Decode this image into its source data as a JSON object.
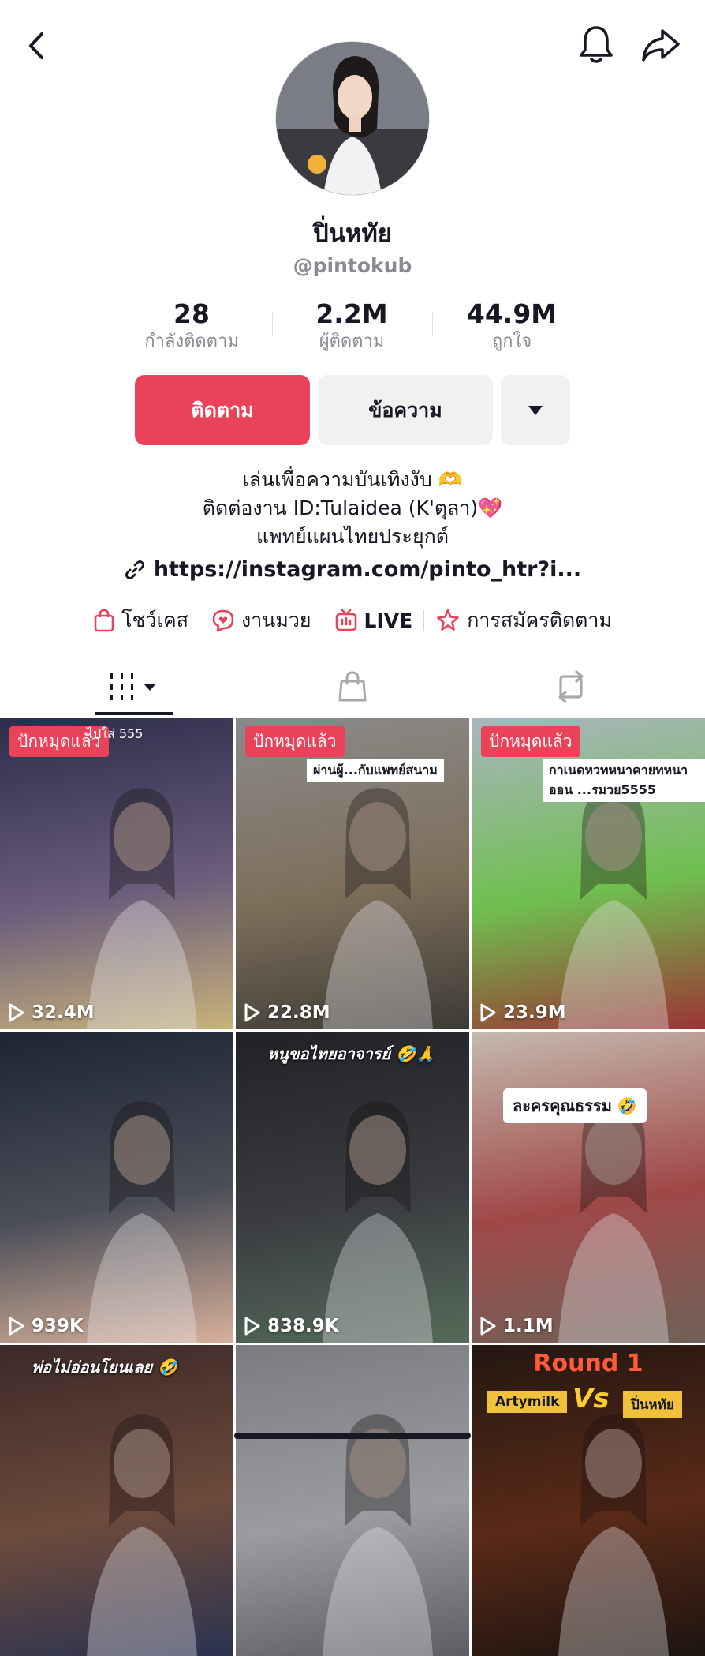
{
  "header": {
    "back_icon": "chevron-left-icon",
    "bell_icon": "bell-icon",
    "share_icon": "share-icon"
  },
  "profile": {
    "display_name": "ปิ่นหทัย",
    "username": "@pintokub",
    "stats": [
      {
        "value": "28",
        "label": "กำลังติดตาม"
      },
      {
        "value": "2.2M",
        "label": "ผู้ติดตาม"
      },
      {
        "value": "44.9M",
        "label": "ถูกใจ"
      }
    ]
  },
  "actions": {
    "follow_label": "ติดตาม",
    "message_label": "ข้อความ"
  },
  "bio": {
    "line1": "เล่นเพื่อความบันเทิงงับ 🫶",
    "line2": "ติดต่องาน ID:Tulaidea (K'ตุลา)💖",
    "line3": "แพทย์แผนไทยประยุกต์",
    "link": "https://instagram.com/pinto_htr?i..."
  },
  "chips": [
    {
      "label": "โชว์เคส",
      "icon": "shopping-bag-icon"
    },
    {
      "label": "งานมวย",
      "icon": "chat-heart-icon"
    },
    {
      "label": "LIVE",
      "icon": "live-tv-icon"
    },
    {
      "label": "การสมัครติดตาม",
      "icon": "star-subscribe-icon"
    }
  ],
  "tabs": [
    {
      "name": "videos",
      "icon": "grid-icon",
      "active": true
    },
    {
      "name": "shop",
      "icon": "bag-icon",
      "active": false
    },
    {
      "name": "reposts",
      "icon": "repost-icon",
      "active": false
    }
  ],
  "videos": [
    {
      "views": "32.4M",
      "pinned": "ปักหมุดแล้ว",
      "caption": "ไปใส่ 555",
      "colors": [
        "#2b2d4a",
        "#6a5c7c",
        "#c8b27a"
      ]
    },
    {
      "views": "22.8M",
      "pinned": "ปักหมุดแล้ว",
      "caption": "ผ่านผู้...กับแพทย์สนาม",
      "colors": [
        "#8a8a8a",
        "#7d6e5a",
        "#3d3b36"
      ]
    },
    {
      "views": "23.9M",
      "pinned": "ปักหมุดแล้ว",
      "caption": "กาเนดหวทหนาคายทหนาออน ...รมวย5555",
      "colors": [
        "#a9b5bf",
        "#6fbf4f",
        "#9c3434"
      ]
    },
    {
      "views": "939K",
      "pinned": "",
      "caption": "",
      "colors": [
        "#1f2433",
        "#4a4e58",
        "#d7b09a"
      ]
    },
    {
      "views": "838.9K",
      "pinned": "",
      "caption": "หนูขอไทยอาจารย์ 🤣🙏",
      "colors": [
        "#202226",
        "#3a3c40",
        "#556b5a"
      ]
    },
    {
      "views": "1.1M",
      "pinned": "",
      "caption": "ละครคุณธรรม 🤣",
      "colors": [
        "#c4b9ad",
        "#a04848",
        "#6f6258"
      ]
    },
    {
      "views": "",
      "pinned": "",
      "caption": "พ่อไม่อ่อนโยนเลย 🤣",
      "colors": [
        "#3c2a28",
        "#6d4a3c",
        "#2a3350"
      ]
    },
    {
      "views": "",
      "pinned": "",
      "caption": "",
      "colors": [
        "#7a7c80",
        "#9a9ca0",
        "#5c5e63"
      ]
    },
    {
      "views": "",
      "pinned": "",
      "caption": "Round 1",
      "vs_left": "Artymilk",
      "vs_mid": "Vs",
      "vs_right": "ปิ่นหทัย",
      "colors": [
        "#241711",
        "#5a2a18",
        "#1c1410"
      ]
    }
  ]
}
